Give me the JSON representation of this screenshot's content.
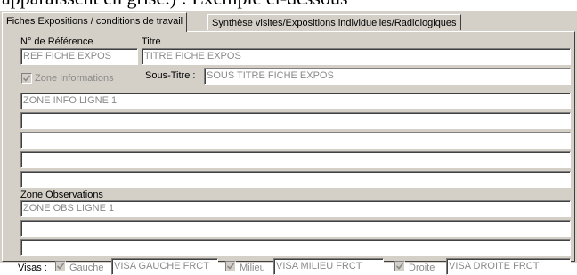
{
  "document_text": "apparaissent en grise.) : Exemple ci-dessous",
  "tabs": [
    {
      "label": "Fiches Expositions / conditions de travail",
      "active": true
    },
    {
      "label": "Synthèse visites/Expositions individuelles/Radiologiques",
      "active": false
    }
  ],
  "form": {
    "ref_label": "N° de Référence",
    "ref_value": "REF FICHE EXPOS",
    "titre_label": "Titre",
    "titre_value": "TITRE FICHE EXPOS",
    "zone_info_checkbox_label": "Zone Informations",
    "zone_info_checked": true,
    "sous_titre_label": "Sous-Titre :",
    "sous_titre_value": "SOUS TITRE FICHE EXPOS",
    "zone_info_lines": [
      "ZONE INFO LIGNE 1",
      "",
      "",
      "",
      ""
    ],
    "zone_obs_label": "Zone Observations",
    "zone_obs_lines": [
      "ZONE OBS LIGNE 1",
      "",
      ""
    ],
    "visas_label": "Visas :",
    "visa_gauche_label": "Gauche",
    "visa_gauche_value": "VISA GAUCHE FRCT",
    "visa_milieu_label": "Milieu",
    "visa_milieu_value": "VISA MILIEU FRCT",
    "visa_droite_label": "Droite",
    "visa_droite_value": "VISA DROITE FRCT"
  },
  "colors": {
    "dialog_bg": "#d4d0c8",
    "disabled_text": "#8a8a8a"
  }
}
